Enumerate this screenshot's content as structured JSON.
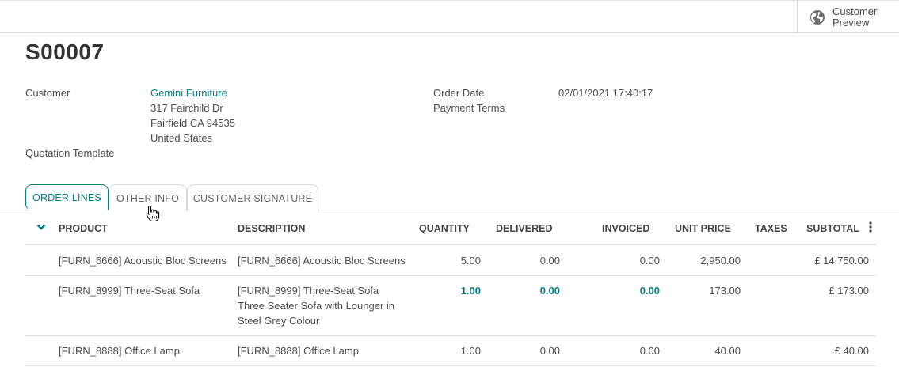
{
  "header": {
    "customer_preview_label": "Customer Preview"
  },
  "record": {
    "title": "S00007"
  },
  "fields": {
    "customer_label": "Customer",
    "customer_name": "Gemini Furniture",
    "customer_address_line1": "317 Fairchild Dr",
    "customer_address_line2": "Fairfield CA 94535",
    "customer_address_line3": "United States",
    "quotation_template_label": "Quotation Template",
    "order_date_label": "Order Date",
    "order_date_value": "02/01/2021 17:40:17",
    "payment_terms_label": "Payment Terms"
  },
  "tabs": [
    {
      "label": "ORDER LINES",
      "active": true
    },
    {
      "label": "OTHER INFO",
      "active": false
    },
    {
      "label": "CUSTOMER SIGNATURE",
      "active": false
    }
  ],
  "table": {
    "columns": [
      "PRODUCT",
      "DESCRIPTION",
      "QUANTITY",
      "DELIVERED",
      "INVOICED",
      "UNIT PRICE",
      "TAXES",
      "SUBTOTAL"
    ],
    "rows": [
      {
        "product": "[FURN_6666] Acoustic Bloc Screens",
        "description_lines": [
          "[FURN_6666] Acoustic Bloc Screens"
        ],
        "quantity": "5.00",
        "delivered": "0.00",
        "invoiced": "0.00",
        "unit_price": "2,950.00",
        "taxes": "",
        "subtotal": "£ 14,750.00"
      },
      {
        "product": "[FURN_8999] Three-Seat Sofa",
        "description_lines": [
          "[FURN_8999] Three-Seat Sofa",
          "Three Seater Sofa with Lounger in",
          "Steel Grey Colour"
        ],
        "quantity": "1.00",
        "delivered": "0.00",
        "invoiced": "0.00",
        "unit_price": "173.00",
        "taxes": "",
        "subtotal": "£ 173.00"
      },
      {
        "product": "[FURN_8888] Office Lamp",
        "description_lines": [
          "[FURN_8888] Office Lamp"
        ],
        "quantity": "1.00",
        "delivered": "0.00",
        "invoiced": "0.00",
        "unit_price": "40.00",
        "taxes": "",
        "subtotal": "£ 40.00"
      }
    ]
  },
  "colors": {
    "accent": "#017e84",
    "text": "#4c4c4c",
    "border": "#d8d8d8"
  }
}
